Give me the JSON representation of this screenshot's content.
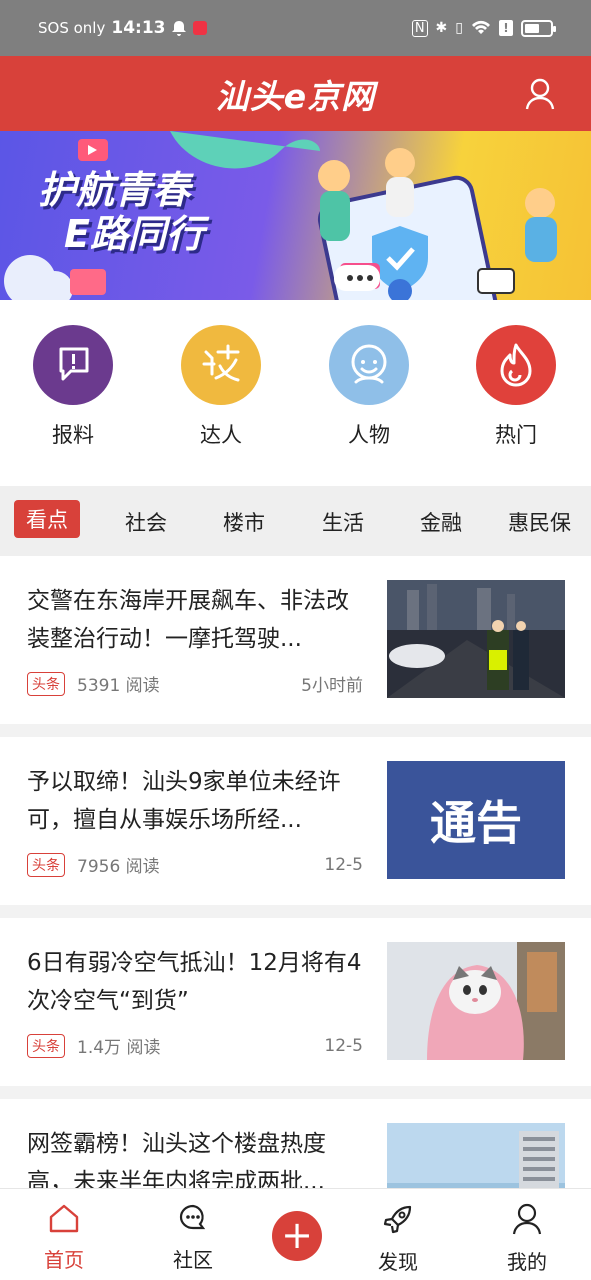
{
  "status_bar": {
    "carrier": "SOS only",
    "time": "14:13",
    "battery_level": 0.6
  },
  "header": {
    "logo_text": "汕头e京网",
    "user_icon": "user-icon"
  },
  "banner": {
    "line1": "护航青春",
    "line2": "E路同行"
  },
  "quick_nav": [
    {
      "label": "报料",
      "icon": "report-icon",
      "color": "#6b3a8e"
    },
    {
      "label": "达人",
      "icon": "expert-icon",
      "color": "#f0b93f"
    },
    {
      "label": "人物",
      "icon": "person-icon",
      "color": "#8fbfe8"
    },
    {
      "label": "热门",
      "icon": "flame-icon",
      "color": "#e0413b"
    }
  ],
  "tabs": [
    "看点",
    "社会",
    "楼市",
    "生活",
    "金融",
    "惠民保"
  ],
  "active_tab": "看点",
  "articles": [
    {
      "title": "交警在东海岸开展飙车、非法改装整治行动！一摩托驾驶...",
      "tag": "头条",
      "reads": "5391 阅读",
      "time": "5小时前",
      "thumb": "night-road-police"
    },
    {
      "title": "予以取缔！汕头9家单位未经许可，擅自从事娱乐场所经...",
      "tag": "头条",
      "reads": "7956 阅读",
      "time": "12-5",
      "thumb": "notice",
      "thumb_text": "通告"
    },
    {
      "title": "6日有弱冷空气抵汕！12月将有4次冷空气“到货”",
      "tag": "头条",
      "reads": "1.4万 阅读",
      "time": "12-5",
      "thumb": "cat-blanket"
    },
    {
      "title": "网签霸榜！汕头这个楼盘热度高，未来半年内将完成两批...",
      "thumb": "building"
    }
  ],
  "bottom_nav": [
    {
      "label": "首页",
      "icon": "home-icon",
      "active": true
    },
    {
      "label": "社区",
      "icon": "chat-bubble-icon"
    },
    {
      "label": "发现",
      "icon": "rocket-icon"
    },
    {
      "label": "我的",
      "icon": "user-icon"
    }
  ],
  "colors": {
    "brand": "#d8413a",
    "status_bar": "#7f7f7f"
  }
}
